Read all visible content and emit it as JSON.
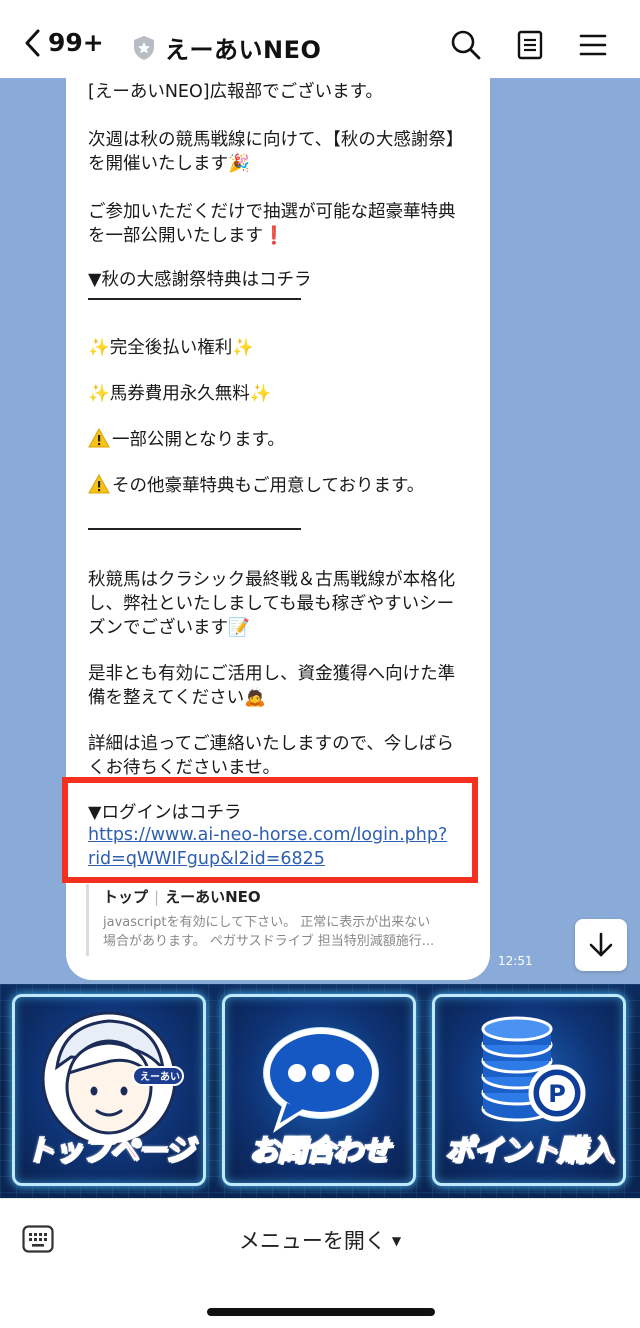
{
  "header": {
    "back_count": "99+",
    "title": "えーあいNEO",
    "icons": [
      "search-icon",
      "notes-icon",
      "menu-icon"
    ]
  },
  "message": {
    "lines": [
      "[えーあいNEO]広報部でございます。",
      "次週は秋の競馬戦線に向けて、【秋の大感謝祭】",
      "を開催いたします",
      "ご参加いただくだけで抽選が可能な超豪華特典",
      "を一部公開いたします",
      "▼秋の大感謝祭特典はコチラ",
      "完全後払い権利",
      "馬券費用永久無料",
      "一部公開となります。",
      "その他豪華特典もご用意しております。",
      "秋競馬はクラシック最終戦＆古馬戦線が本格化",
      "し、弊社といたしましても最も稼ぎやすいシー",
      "ズンでございます",
      "是非とも有効にご活用し、資金獲得へ向けた準",
      "備を整えてください",
      "詳細は追ってご連絡いたしますので、今しばら",
      "くお待ちくださいませ。"
    ],
    "emoji": {
      "party": "🎉",
      "exclaim": "❗",
      "sparkle": "✨",
      "memo": "📝",
      "bow": "🙇"
    },
    "login_label": "▼ログインはコチラ",
    "login_url_line1": "https://www.ai-neo-horse.com/login.php?",
    "login_url_line2": "rid=qWWIFgup&l2id=6825",
    "highlight_color": "#f5301f"
  },
  "link_preview": {
    "title_left": "トップ",
    "separator": "|",
    "title_right": "えーあいNEO",
    "desc_line1": "javascriptを有効にして下さい。 正常に表示が出来ない",
    "desc_line2": "場合があります。 ペガサスドライブ 担当特別減額施行..."
  },
  "timestamp": "12:51",
  "rich_menu": {
    "tiles": [
      {
        "label": "トップページ",
        "icon": "avatar-icon"
      },
      {
        "label": "お問合わせ",
        "icon": "chat-bubble-icon"
      },
      {
        "label": "ポイント購入",
        "icon": "coins-icon"
      }
    ],
    "badge_text": "えーあい",
    "coin_letter": "P",
    "label_color": "#ff3c8e",
    "frame_color": "#bfe9ff"
  },
  "bottom_bar": {
    "menu_toggle_label": "メニューを開く",
    "menu_toggle_caret": "▼"
  }
}
